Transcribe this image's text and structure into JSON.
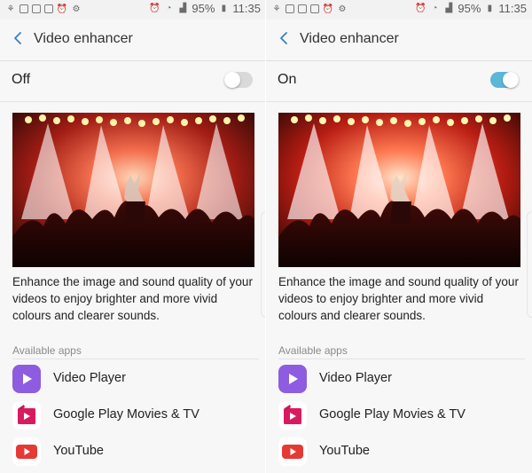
{
  "status_bar": {
    "battery": "95%",
    "time": "11:35"
  },
  "screens": [
    {
      "title": "Video enhancer",
      "toggle_label": "Off",
      "toggle_state": "off",
      "description": "Enhance the image and sound quality of your videos to enjoy brighter and more vivid colours and clearer sounds.",
      "section_label": "Available apps",
      "apps": [
        "Video Player",
        "Google Play Movies & TV",
        "YouTube"
      ]
    },
    {
      "title": "Video enhancer",
      "toggle_label": "On",
      "toggle_state": "on",
      "description": "Enhance the image and sound quality of your videos to enjoy brighter and more vivid colours and clearer sounds.",
      "section_label": "Available apps",
      "apps": [
        "Video Player",
        "Google Play Movies & TV",
        "YouTube"
      ]
    }
  ],
  "icons": {
    "back": "back-arrow-icon",
    "video_player": "video-player-icon",
    "play_movies": "google-play-movies-icon",
    "youtube": "youtube-icon"
  },
  "colors": {
    "toggle_on": "#5bb6d8",
    "toggle_off": "#d9d9d9",
    "back_arrow": "#3a7fc0",
    "video_player": "#8e5ce0",
    "play_movies": "#d81b60",
    "youtube": "#e53935"
  }
}
